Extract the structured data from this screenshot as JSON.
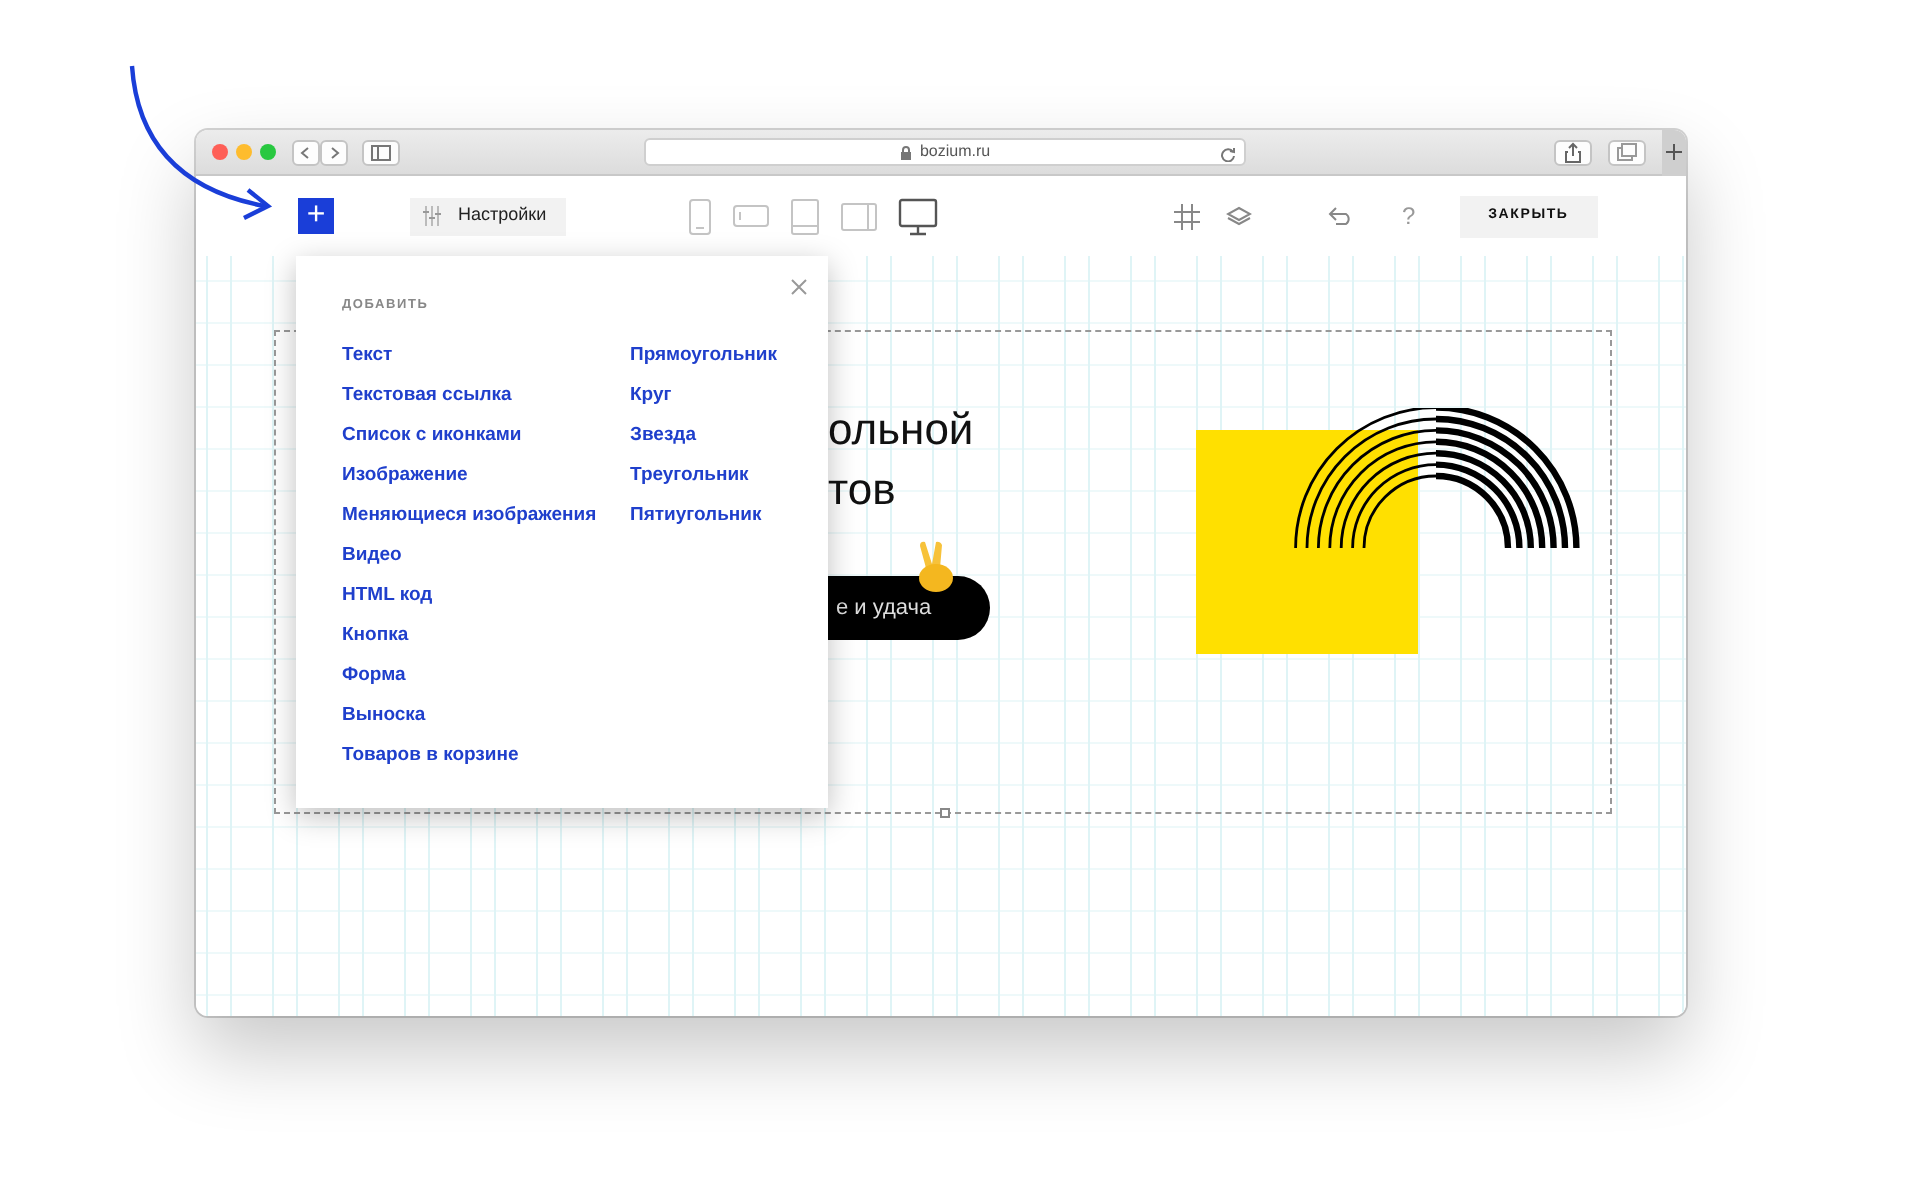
{
  "browser": {
    "url": "bozium.ru"
  },
  "toolbar": {
    "add_button": "+",
    "settings_button": "Настройки",
    "devices": [
      {
        "kind": "phone",
        "selected": false
      },
      {
        "kind": "phone-landscape",
        "selected": false
      },
      {
        "kind": "tablet",
        "selected": false
      },
      {
        "kind": "tablet-landscape",
        "selected": false
      },
      {
        "kind": "desktop",
        "selected": true
      }
    ],
    "help": "?",
    "close_button": "ЗАКРЫТЬ"
  },
  "add_menu": {
    "heading": "ДОБАВИТЬ",
    "columns": [
      [
        "Текст",
        "Текстовая ссылка",
        "Список с иконками",
        "Изображение",
        "Меняющиеся изображения",
        "Видео",
        "HTML код",
        "Кнопка",
        "Форма",
        "Выноска",
        "Товаров в корзине"
      ],
      [
        "Прямоугольник",
        "Круг",
        "Звезда",
        "Треугольник",
        "Пятиугольник"
      ]
    ]
  },
  "canvas": {
    "heading_lines": [
      "ольной",
      "тов"
    ],
    "button": "е и удача"
  }
}
